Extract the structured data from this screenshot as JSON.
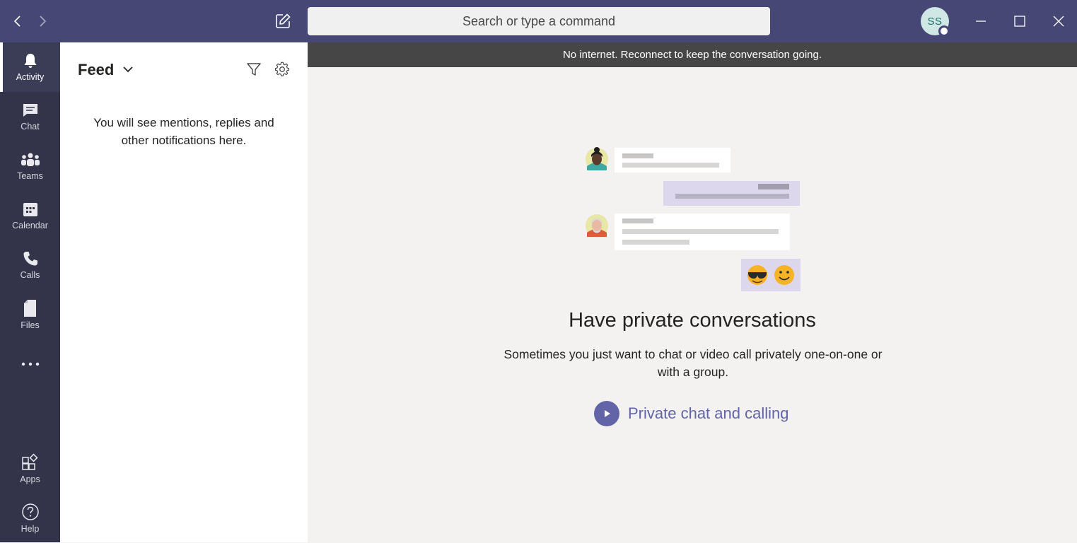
{
  "titlebar": {
    "search_placeholder": "Search or type a command",
    "avatar_initials": "SS",
    "bg_color": "#464775"
  },
  "rail": {
    "items": [
      {
        "label": "Activity",
        "icon": "bell-icon",
        "active": true
      },
      {
        "label": "Chat",
        "icon": "chat-icon"
      },
      {
        "label": "Teams",
        "icon": "teams-icon"
      },
      {
        "label": "Calendar",
        "icon": "calendar-icon"
      },
      {
        "label": "Calls",
        "icon": "phone-icon"
      },
      {
        "label": "Files",
        "icon": "file-icon"
      },
      {
        "label": "",
        "icon": "more-icon"
      }
    ],
    "bottom_items": [
      {
        "label": "Apps",
        "icon": "apps-icon"
      },
      {
        "label": "Help",
        "icon": "help-icon"
      }
    ]
  },
  "feed": {
    "title": "Feed",
    "empty_message": "You will see mentions, replies and other notifications here."
  },
  "main": {
    "offline_banner": "No internet. Reconnect to keep the conversation going.",
    "headline": "Have private conversations",
    "subtext": "Sometimes you just want to chat or video call privately one-on-one or with a group.",
    "link_label": "Private chat and calling",
    "accent_color": "#6264a7"
  }
}
